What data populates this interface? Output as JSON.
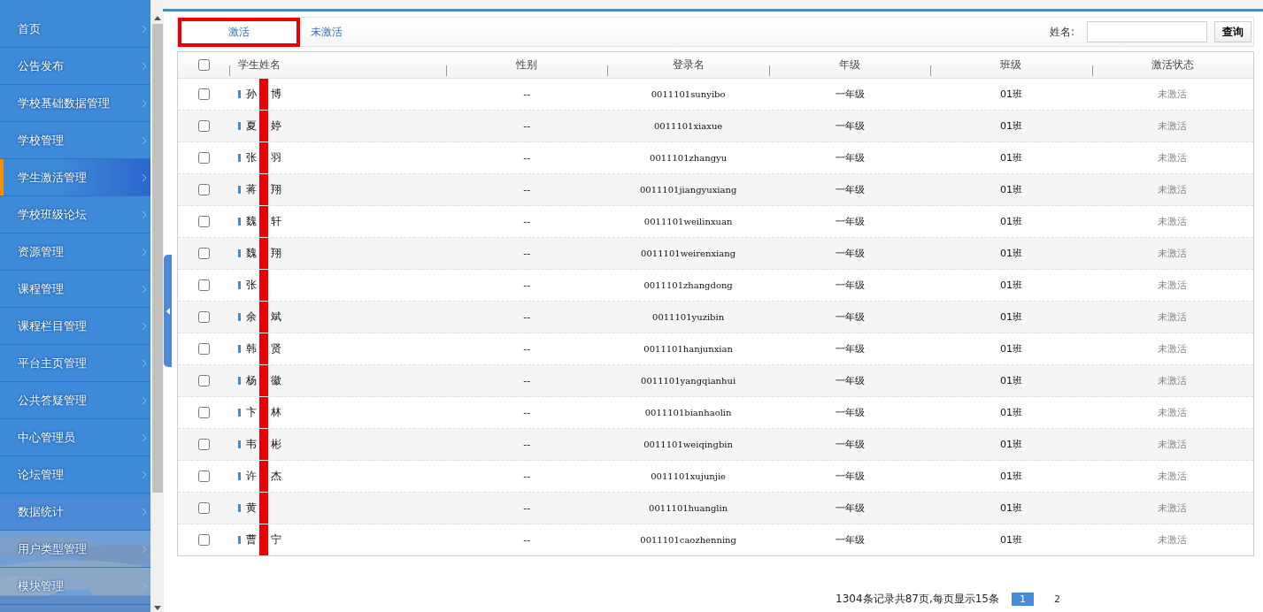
{
  "sidebar": {
    "items": [
      {
        "label": "首页",
        "selected": false
      },
      {
        "label": "公告发布",
        "selected": false
      },
      {
        "label": "学校基础数据管理",
        "selected": false
      },
      {
        "label": "学校管理",
        "selected": false
      },
      {
        "label": "学生激活管理",
        "selected": true
      },
      {
        "label": "学校班级论坛",
        "selected": false
      },
      {
        "label": "资源管理",
        "selected": false
      },
      {
        "label": "课程管理",
        "selected": false
      },
      {
        "label": "课程栏目管理",
        "selected": false
      },
      {
        "label": "平台主页管理",
        "selected": false
      },
      {
        "label": "公共答疑管理",
        "selected": false
      },
      {
        "label": "中心管理员",
        "selected": false
      },
      {
        "label": "论坛管理",
        "selected": false
      },
      {
        "label": "数据统计",
        "selected": false
      },
      {
        "label": "用户类型管理",
        "selected": false
      },
      {
        "label": "模块管理",
        "selected": false
      }
    ]
  },
  "tabs": [
    {
      "label": "激活",
      "selected": true,
      "highlighted": true
    },
    {
      "label": "未激活",
      "selected": false,
      "highlighted": false
    }
  ],
  "search": {
    "label": "姓名:",
    "button": "查询"
  },
  "table": {
    "columns": [
      "学生姓名",
      "性别",
      "登录名",
      "年级",
      "班级",
      "激活状态"
    ],
    "select_all": false,
    "rows": [
      {
        "checked": false,
        "name_start": "孙",
        "name_end": "博",
        "gender": "--",
        "login": "0011101sunyibo",
        "grade": "一年级",
        "class": "01班",
        "status": "未激活"
      },
      {
        "checked": false,
        "name_start": "夏",
        "name_end": "婷",
        "gender": "--",
        "login": "0011101xiaxue",
        "grade": "一年级",
        "class": "01班",
        "status": "未激活"
      },
      {
        "checked": false,
        "name_start": "张",
        "name_end": "羽",
        "gender": "--",
        "login": "0011101zhangyu",
        "grade": "一年级",
        "class": "01班",
        "status": "未激活"
      },
      {
        "checked": false,
        "name_start": "蒋",
        "name_end": "翔",
        "gender": "--",
        "login": "0011101jiangyuxiang",
        "grade": "一年级",
        "class": "01班",
        "status": "未激活"
      },
      {
        "checked": false,
        "name_start": "魏",
        "name_end": "轩",
        "gender": "--",
        "login": "0011101weilinxuan",
        "grade": "一年级",
        "class": "01班",
        "status": "未激活"
      },
      {
        "checked": false,
        "name_start": "魏",
        "name_end": "翔",
        "gender": "--",
        "login": "0011101weirenxiang",
        "grade": "一年级",
        "class": "01班",
        "status": "未激活"
      },
      {
        "checked": false,
        "name_start": "张",
        "gender": "--",
        "login": "0011101zhangdong",
        "grade": "一年级",
        "class": "01班",
        "status": "未激活"
      },
      {
        "checked": false,
        "name_start": "余",
        "name_end": "斌",
        "gender": "--",
        "login": "0011101yuzibin",
        "grade": "一年级",
        "class": "01班",
        "status": "未激活"
      },
      {
        "checked": false,
        "name_start": "韩",
        "name_end": "贤",
        "gender": "--",
        "login": "0011101hanjunxian",
        "grade": "一年级",
        "class": "01班",
        "status": "未激活"
      },
      {
        "checked": false,
        "name_start": "杨",
        "name_end": "徽",
        "gender": "--",
        "login": "0011101yangqianhui",
        "grade": "一年级",
        "class": "01班",
        "status": "未激活"
      },
      {
        "checked": false,
        "name_start": "卞",
        "name_end": "林",
        "gender": "--",
        "login": "0011101bianhaolin",
        "grade": "一年级",
        "class": "01班",
        "status": "未激活"
      },
      {
        "checked": false,
        "name_start": "韦",
        "name_end": "彬",
        "gender": "--",
        "login": "0011101weiqingbin",
        "grade": "一年级",
        "class": "01班",
        "status": "未激活"
      },
      {
        "checked": false,
        "name_start": "许",
        "name_end": "杰",
        "gender": "--",
        "login": "0011101xujunjie",
        "grade": "一年级",
        "class": "01班",
        "status": "未激活"
      },
      {
        "checked": false,
        "name_start": "黄",
        "gender": "--",
        "login": "0011101huanglin",
        "grade": "一年级",
        "class": "01班",
        "status": "未激活"
      },
      {
        "checked": false,
        "name_start": "曹",
        "name_end": "宁",
        "gender": "--",
        "login": "0011101caozhenning",
        "grade": "一年级",
        "class": "01班",
        "status": "未激活"
      }
    ]
  },
  "pagination": {
    "summary": "1304条记录共87页,每页显示15条",
    "pages": [
      {
        "label": "1",
        "selected": true
      },
      {
        "label": "2",
        "selected": false
      }
    ]
  }
}
